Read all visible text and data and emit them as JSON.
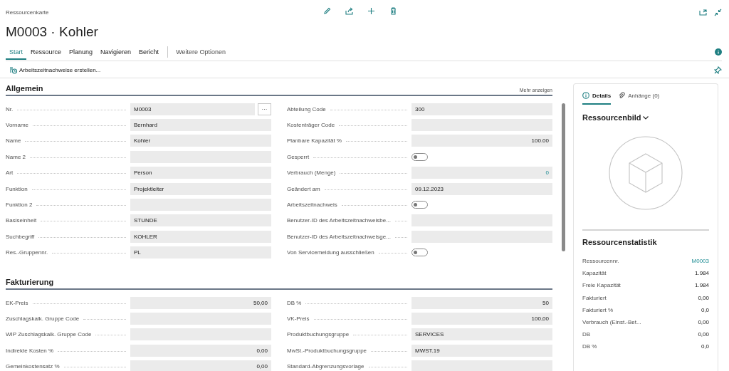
{
  "page": {
    "caption": "Ressourcenkarte",
    "title": "M0003 · Kohler"
  },
  "nav_tabs": [
    {
      "label": "Start",
      "kind": "tab",
      "selected": true
    },
    {
      "label": "Ressource",
      "kind": "tab",
      "selected": false
    },
    {
      "label": "Planung",
      "kind": "tab",
      "selected": false
    },
    {
      "label": "Navigieren",
      "kind": "tab",
      "selected": false
    },
    {
      "label": "Bericht",
      "kind": "tab",
      "selected": false
    },
    {
      "label": "Weitere Optionen",
      "kind": "more",
      "selected": false
    }
  ],
  "actions": [
    {
      "label": "Arbeitszeitnachweise erstellen..."
    }
  ],
  "sections": [
    {
      "title": "Allgemein",
      "link": "Mehr anzeigen",
      "columns": [
        [
          {
            "label": "Nr.",
            "kind": "text",
            "value": "M0003",
            "assist": "···"
          },
          {
            "label": "Vorname",
            "kind": "text",
            "value": "Bernhard"
          },
          {
            "label": "Name",
            "kind": "text",
            "value": "Kohler"
          },
          {
            "label": "Name 2",
            "kind": "text"
          },
          {
            "label": "Art",
            "kind": "text",
            "value": "Person"
          },
          {
            "label": "Funktion",
            "kind": "text",
            "value": "Projektleiter"
          },
          {
            "label": "Funktion 2",
            "kind": "text"
          },
          {
            "label": "Basiseinheit",
            "kind": "text",
            "value": "STUNDE"
          },
          {
            "label": "Suchbegriff",
            "kind": "text",
            "value": "KOHLER"
          },
          {
            "label": "Res.-Gruppennr.",
            "kind": "text",
            "value": "PL"
          }
        ],
        [
          {
            "label": "Abteilung Code",
            "kind": "text",
            "value": "300"
          },
          {
            "label": "Kostenträger Code",
            "kind": "text"
          },
          {
            "label": "Planbare Kapazität %",
            "kind": "number",
            "value": "100.00"
          },
          {
            "label": "Gesperrt",
            "kind": "toggle",
            "on": false
          },
          {
            "label": "Verbrauch (Menge)",
            "kind": "link",
            "value": "0"
          },
          {
            "label": "Geändert am",
            "kind": "text",
            "value": "09.12.2023"
          },
          {
            "label": "Arbeitszeitnachweis",
            "kind": "toggle",
            "on": false
          },
          {
            "label": "Benutzer-ID des Arbeitszeitnachweisbe...",
            "kind": "text"
          },
          {
            "label": "Benutzer-ID des Arbeitszeitnachweisge...",
            "kind": "text"
          },
          {
            "label": "Von Servicemeldung ausschließen",
            "kind": "toggle",
            "on": false
          }
        ]
      ]
    },
    {
      "title": "Fakturierung",
      "columns": [
        [
          {
            "label": "EK-Preis",
            "kind": "number",
            "value": "50,00"
          },
          {
            "label": "Zuschlagskalk. Gruppe Code",
            "kind": "text"
          },
          {
            "label": "WIP Zuschlagskalk. Gruppe Code",
            "kind": "text"
          },
          {
            "label": "Indirekte Kosten %",
            "kind": "number",
            "value": "0,00"
          },
          {
            "label": "Gemeinkostensatz %",
            "kind": "number",
            "value": "0,00"
          }
        ],
        [
          {
            "label": "DB %",
            "kind": "number",
            "value": "50"
          },
          {
            "label": "VK-Preis",
            "kind": "number",
            "value": "100,00"
          },
          {
            "label": "Produktbuchungsgruppe",
            "kind": "text",
            "value": "SERVICES"
          },
          {
            "label": "MwSt.-Produktbuchungsgruppe",
            "kind": "text",
            "value": "MWST.19"
          },
          {
            "label": "Standard-Abgrenzungsvorlage",
            "kind": "text"
          }
        ]
      ]
    }
  ],
  "factbox": {
    "tabs": [
      {
        "label": "Details",
        "selected": true
      },
      {
        "label": "Anhänge (0)",
        "selected": false
      }
    ],
    "picture_title": "Ressourcenbild",
    "statistics_title": "Ressourcenstatistik",
    "statistics": [
      {
        "label": "Ressourcennr.",
        "kind": "link",
        "value": "M0003"
      },
      {
        "label": "Kapazität",
        "kind": "number",
        "value": "1.984"
      },
      {
        "label": "Freie Kapazität",
        "kind": "number",
        "value": "1.984"
      },
      {
        "label": "Fakturiert",
        "kind": "number",
        "value": "0,00"
      },
      {
        "label": "Fakturiert %",
        "kind": "number",
        "value": "0,0"
      },
      {
        "label": "Verbrauch (Einst.-Bet...",
        "kind": "number",
        "value": "0,00"
      },
      {
        "label": "DB",
        "kind": "number",
        "value": "0,00"
      },
      {
        "label": "DB %",
        "kind": "number",
        "value": "0,0"
      }
    ]
  }
}
